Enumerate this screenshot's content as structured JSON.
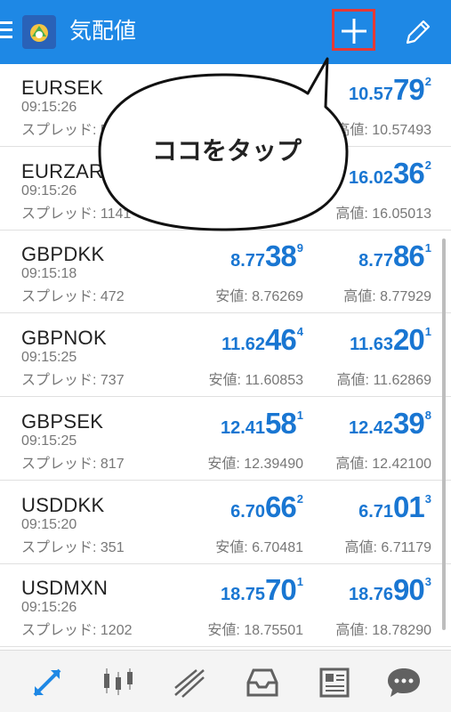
{
  "header": {
    "title": "気配値",
    "add_label": "+",
    "edit_icon": "pencil-icon",
    "menu_icon": "hamburger-icon",
    "logo_icon": "app-logo-icon"
  },
  "colors": {
    "header_bg": "#1e88e5",
    "price": "#1976d2",
    "highlight_box": "#e53935"
  },
  "annotation": {
    "text": "ココをタップ"
  },
  "quotes": [
    {
      "symbol": "EURSEK",
      "time": "09:15:26",
      "spread": "スプレッド: 5",
      "ask": {
        "small": "10.57",
        "big": "79",
        "sup": "2"
      },
      "high": "高値: 10.57493"
    },
    {
      "symbol": "EURZAR",
      "time": "09:15:26",
      "spread": "スプレッド: 1141",
      "ask": {
        "small": "16.02",
        "big": "36",
        "sup": "2"
      },
      "high": "高値: 16.05013"
    },
    {
      "symbol": "GBPDKK",
      "time": "09:15:18",
      "spread": "スプレッド: 472",
      "bid": {
        "small": "8.77",
        "big": "38",
        "sup": "9"
      },
      "ask": {
        "small": "8.77",
        "big": "86",
        "sup": "1"
      },
      "low": "安値: 8.76269",
      "high": "高値: 8.77929"
    },
    {
      "symbol": "GBPNOK",
      "time": "09:15:25",
      "spread": "スプレッド: 737",
      "bid": {
        "small": "11.62",
        "big": "46",
        "sup": "4"
      },
      "ask": {
        "small": "11.63",
        "big": "20",
        "sup": "1"
      },
      "low": "安値: 11.60853",
      "high": "高値: 11.62869"
    },
    {
      "symbol": "GBPSEK",
      "time": "09:15:25",
      "spread": "スプレッド: 817",
      "bid": {
        "small": "12.41",
        "big": "58",
        "sup": "1"
      },
      "ask": {
        "small": "12.42",
        "big": "39",
        "sup": "8"
      },
      "low": "安値: 12.39490",
      "high": "高値: 12.42100"
    },
    {
      "symbol": "USDDKK",
      "time": "09:15:20",
      "spread": "スプレッド: 351",
      "bid": {
        "small": "6.70",
        "big": "66",
        "sup": "2"
      },
      "ask": {
        "small": "6.71",
        "big": "01",
        "sup": "3"
      },
      "low": "安値: 6.70481",
      "high": "高値: 6.71179"
    },
    {
      "symbol": "USDMXN",
      "time": "09:15:26",
      "spread": "スプレッド: 1202",
      "bid": {
        "small": "18.75",
        "big": "70",
        "sup": "1"
      },
      "ask": {
        "small": "18.76",
        "big": "90",
        "sup": "3"
      },
      "low": "安値: 18.75501",
      "high": "高値: 18.78290"
    }
  ],
  "bottom_nav": [
    {
      "icon": "quotes-arrows-icon",
      "active": true
    },
    {
      "icon": "candlestick-chart-icon",
      "active": false
    },
    {
      "icon": "trade-lines-icon",
      "active": false
    },
    {
      "icon": "inbox-tray-icon",
      "active": false
    },
    {
      "icon": "news-icon",
      "active": false
    },
    {
      "icon": "chat-bubble-icon",
      "active": false
    }
  ]
}
